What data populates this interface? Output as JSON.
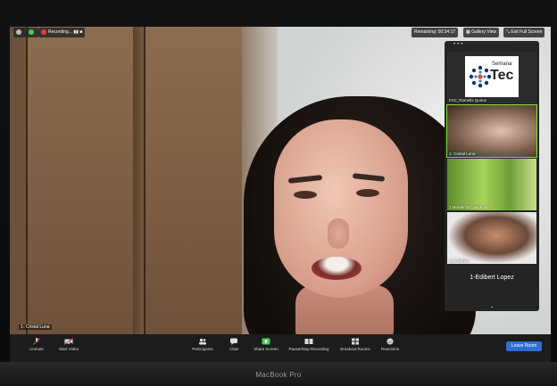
{
  "topbar": {
    "recording_label": "Recording...",
    "remaining_label": "Remaining: 00:34:17",
    "gallery_view_label": "Gallery View",
    "exit_fullscreen_label": "Exit Full Screen"
  },
  "main_video": {
    "participant_name": "1- Cristal Luna"
  },
  "panel": {
    "tiles": [
      {
        "name": "FAC_Romelis Quiroz",
        "logo_top": "Semana",
        "logo_bottom": "Tec"
      },
      {
        "name": "1- Cristal Luna"
      },
      {
        "name": "1.Monterrat Canchola"
      },
      {
        "name": "Luis Nuñez"
      }
    ],
    "highlighted_name": "1-Edibert Lopez"
  },
  "toolbar": {
    "unmute_label": "Unmute",
    "start_video_label": "Start Video",
    "participants_label": "Participants",
    "participants_count": "2",
    "chat_label": "Chat",
    "share_screen_label": "Share Screen",
    "pause_recording_label": "Pause/Stop Recording",
    "breakout_rooms_label": "Breakout Rooms",
    "reactions_label": "Reactions",
    "leave_room_label": "Leave Room"
  },
  "device": {
    "brand": "MacBook Pro"
  },
  "colors": {
    "accent_blue": "#2d6fd6",
    "share_green": "#3ecf5a",
    "speaking_outline": "#7ddc3c"
  }
}
